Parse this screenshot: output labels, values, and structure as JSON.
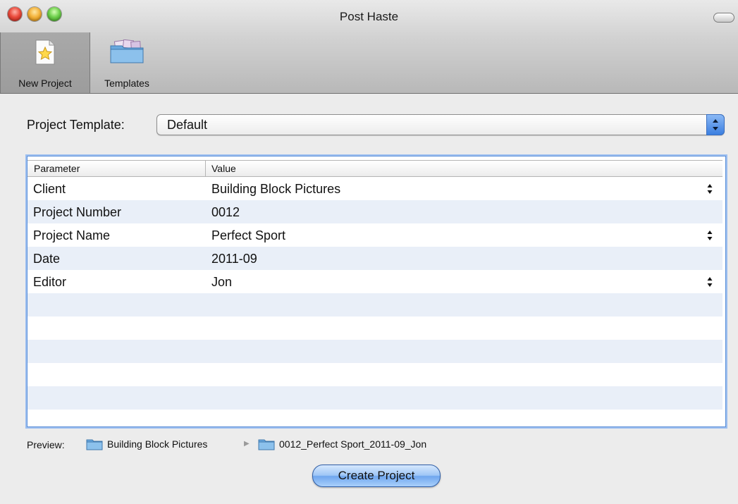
{
  "window": {
    "title": "Post Haste"
  },
  "toolbar": {
    "new_project_label": "New Project",
    "templates_label": "Templates"
  },
  "template": {
    "label": "Project Template:",
    "selected": "Default"
  },
  "table": {
    "columns": [
      "Parameter",
      "Value"
    ],
    "rows": [
      {
        "parameter": "Client",
        "value": "Building Block Pictures"
      },
      {
        "parameter": "Project Number",
        "value": "0012"
      },
      {
        "parameter": "Project Name",
        "value": "Perfect Sport"
      },
      {
        "parameter": "Date",
        "value": "2011-09"
      },
      {
        "parameter": "Editor",
        "value": "Jon"
      }
    ]
  },
  "preview": {
    "label": "Preview:",
    "path": [
      "Building Block Pictures",
      "0012_Perfect Sport_2011-09_Jon"
    ]
  },
  "actions": {
    "create_label": "Create Project"
  },
  "colors": {
    "accent": "#3b7fe0",
    "row_alt": "#e9eff8",
    "folder": "#7fb7e6"
  },
  "icons": {
    "new_project": "star-document-icon",
    "templates": "photo-folder-icon",
    "folder": "folder-icon"
  }
}
